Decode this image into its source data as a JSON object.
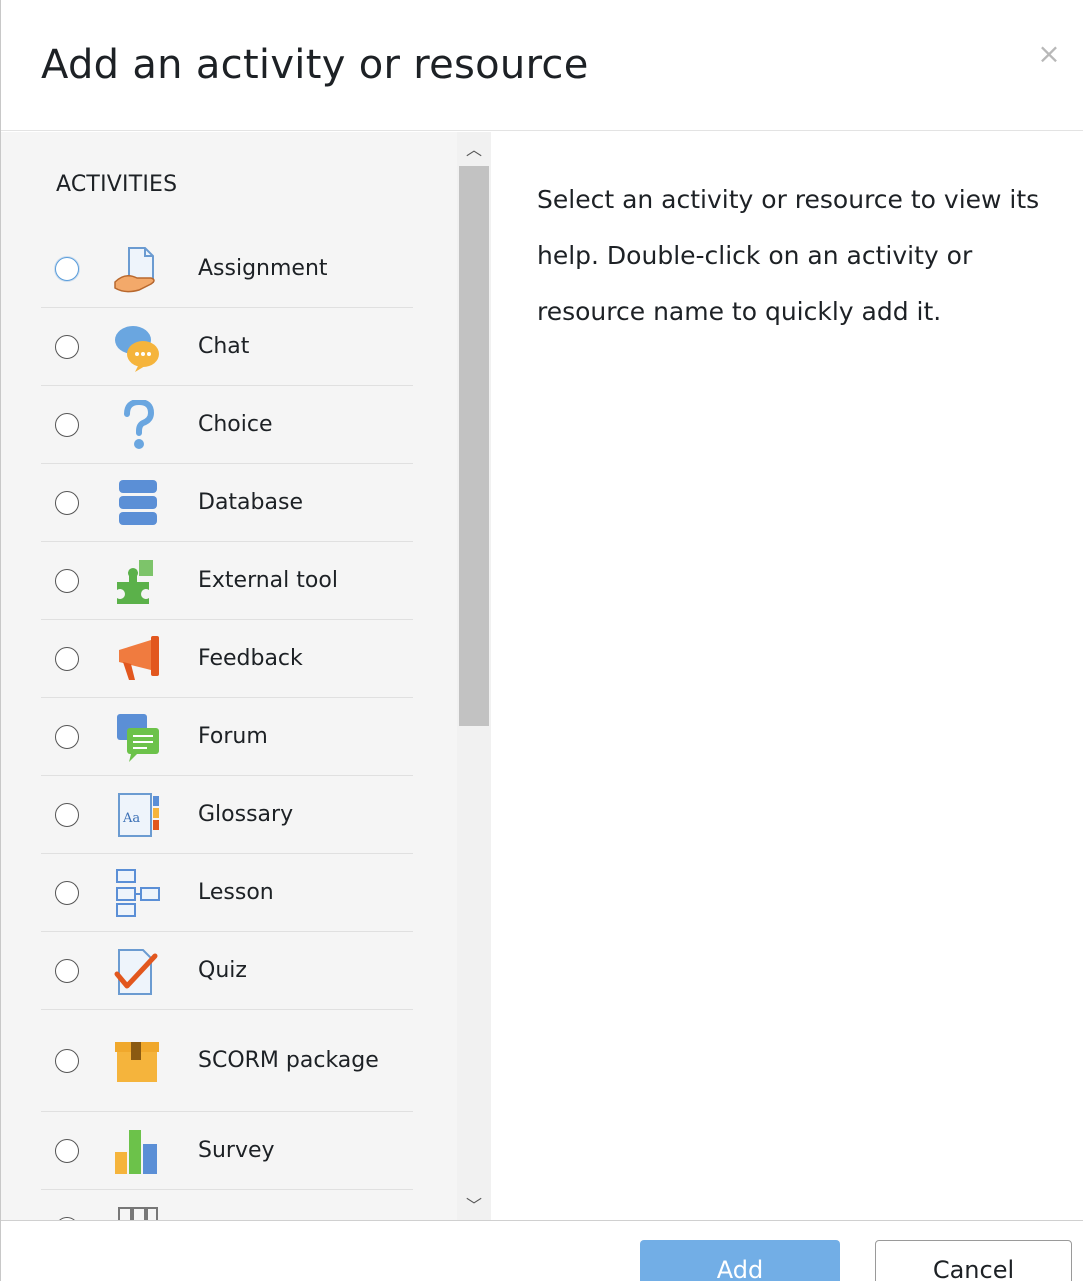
{
  "dialog": {
    "title": "Add an activity or resource",
    "close_label": "×"
  },
  "activities": {
    "heading": "ACTIVITIES",
    "items": [
      {
        "label": "Assignment",
        "icon": "assignment-icon",
        "selected": false
      },
      {
        "label": "Chat",
        "icon": "chat-icon",
        "selected": false
      },
      {
        "label": "Choice",
        "icon": "choice-icon",
        "selected": false
      },
      {
        "label": "Database",
        "icon": "database-icon",
        "selected": false
      },
      {
        "label": "External tool",
        "icon": "external-tool-icon",
        "selected": false
      },
      {
        "label": "Feedback",
        "icon": "feedback-icon",
        "selected": false
      },
      {
        "label": "Forum",
        "icon": "forum-icon",
        "selected": false
      },
      {
        "label": "Glossary",
        "icon": "glossary-icon",
        "selected": false
      },
      {
        "label": "Lesson",
        "icon": "lesson-icon",
        "selected": false
      },
      {
        "label": "Quiz",
        "icon": "quiz-icon",
        "selected": false
      },
      {
        "label": "SCORM package",
        "icon": "scorm-package-icon",
        "selected": false
      },
      {
        "label": "Survey",
        "icon": "survey-icon",
        "selected": false
      },
      {
        "label": "",
        "icon": "wiki-icon",
        "selected": false
      }
    ]
  },
  "help": {
    "text": "Select an activity or resource to view its help. Double-click on an activity or resource name to quickly add it."
  },
  "footer": {
    "add_label": "Add",
    "cancel_label": "Cancel"
  },
  "colors": {
    "primary_button": "#72aee6",
    "focus_ring": "#5a9ddb",
    "pane_background": "#f5f5f5"
  }
}
